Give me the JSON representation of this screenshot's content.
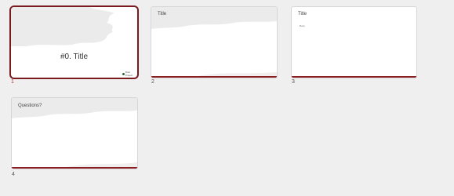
{
  "slides": [
    {
      "number": "1",
      "title": "#0. Title",
      "logo_text": "Rust Project"
    },
    {
      "number": "2",
      "title": "Title"
    },
    {
      "number": "3",
      "title": "Title",
      "body_text": "Body"
    },
    {
      "number": "4",
      "title": "Questions?"
    }
  ],
  "colors": {
    "selected_border": "#7a1a1e",
    "accent_bar": "#8a1e22",
    "background": "#efefef"
  }
}
